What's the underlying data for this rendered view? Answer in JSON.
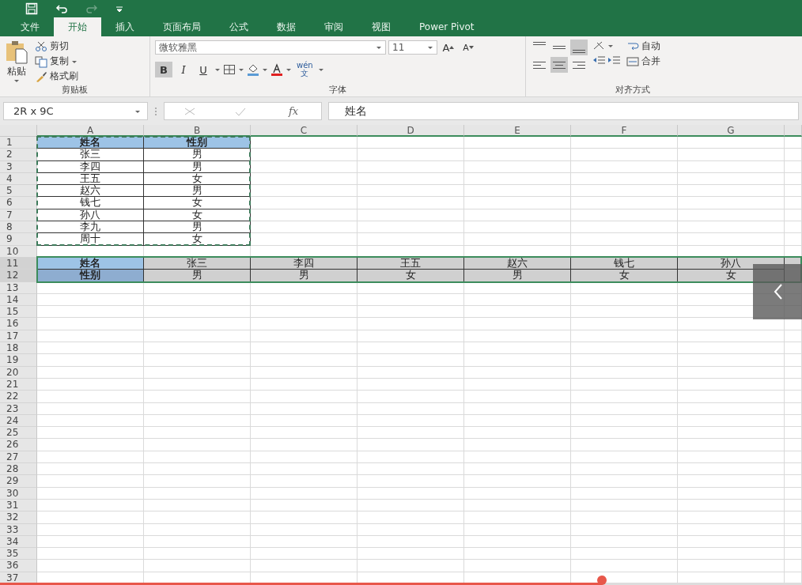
{
  "ribbon_tabs": [
    {
      "label": "文件",
      "selected": false
    },
    {
      "label": "开始",
      "selected": true
    },
    {
      "label": "插入",
      "selected": false
    },
    {
      "label": "页面布局",
      "selected": false
    },
    {
      "label": "公式",
      "selected": false
    },
    {
      "label": "数据",
      "selected": false
    },
    {
      "label": "审阅",
      "selected": false
    },
    {
      "label": "视图",
      "selected": false
    },
    {
      "label": "Power Pivot",
      "selected": false
    }
  ],
  "clipboard": {
    "paste": "粘贴",
    "cut": "剪切",
    "copy": "复制",
    "format_painter": "格式刷",
    "group_label": "剪贴板"
  },
  "font": {
    "name": "微软雅黑",
    "size": "11",
    "grow": "A",
    "shrink": "A",
    "bold": "B",
    "bold_active": true,
    "italic": "I",
    "underline": "U",
    "phonetic_top": "wén",
    "phonetic_bottom": "文",
    "group_label": "字体"
  },
  "alignment": {
    "vertical": [
      {
        "kind": "top",
        "selected": false
      },
      {
        "kind": "middle",
        "selected": false
      },
      {
        "kind": "bottom",
        "selected": true
      }
    ],
    "horizontal": [
      {
        "kind": "left",
        "selected": false
      },
      {
        "kind": "center",
        "selected": true
      },
      {
        "kind": "right",
        "selected": false
      }
    ],
    "wrap": "自动",
    "merge": "合并",
    "group_label": "对齐方式"
  },
  "formula_bar": {
    "name_box": "2R x 9C",
    "fx": "fx",
    "content": "姓名"
  },
  "sheet": {
    "columns": [
      "A",
      "B",
      "C",
      "D",
      "E",
      "F",
      "G"
    ],
    "rows": [
      {
        "header": "1",
        "selected": false,
        "cells": [
          {
            "text": "姓名",
            "kind": "copied_head"
          },
          {
            "text": "性别",
            "kind": "copied_head"
          }
        ]
      },
      {
        "header": "2",
        "selected": false,
        "cells": [
          {
            "text": "张三",
            "kind": "copied"
          },
          {
            "text": "男",
            "kind": "copied"
          }
        ]
      },
      {
        "header": "3",
        "selected": false,
        "cells": [
          {
            "text": "李四",
            "kind": "copied"
          },
          {
            "text": "男",
            "kind": "copied"
          }
        ]
      },
      {
        "header": "4",
        "selected": false,
        "cells": [
          {
            "text": "王五",
            "kind": "copied"
          },
          {
            "text": "女",
            "kind": "copied"
          }
        ]
      },
      {
        "header": "5",
        "selected": false,
        "cells": [
          {
            "text": "赵六",
            "kind": "copied"
          },
          {
            "text": "男",
            "kind": "copied"
          }
        ]
      },
      {
        "header": "6",
        "selected": false,
        "cells": [
          {
            "text": "钱七",
            "kind": "copied"
          },
          {
            "text": "女",
            "kind": "copied"
          }
        ]
      },
      {
        "header": "7",
        "selected": false,
        "cells": [
          {
            "text": "孙八",
            "kind": "copied"
          },
          {
            "text": "女",
            "kind": "copied"
          }
        ]
      },
      {
        "header": "8",
        "selected": false,
        "cells": [
          {
            "text": "李九",
            "kind": "copied"
          },
          {
            "text": "男",
            "kind": "copied"
          }
        ]
      },
      {
        "header": "9",
        "selected": false,
        "cells": [
          {
            "text": "周十",
            "kind": "copied"
          },
          {
            "text": "女",
            "kind": "copied"
          }
        ]
      },
      {
        "header": "10",
        "selected": false
      },
      {
        "header": "11",
        "selected": true,
        "cells": [
          {
            "text": "姓名",
            "kind": "label"
          },
          {
            "text": "张三",
            "kind": "filled"
          },
          {
            "text": "李四",
            "kind": "filled"
          },
          {
            "text": "王五",
            "kind": "filled"
          },
          {
            "text": "赵六",
            "kind": "filled"
          },
          {
            "text": "钱七",
            "kind": "filled"
          },
          {
            "text": "孙八",
            "kind": "filled"
          }
        ]
      },
      {
        "header": "12",
        "selected": true,
        "cells": [
          {
            "text": "性别",
            "kind": "label_dark"
          },
          {
            "text": "男",
            "kind": "filled"
          },
          {
            "text": "男",
            "kind": "filled"
          },
          {
            "text": "女",
            "kind": "filled"
          },
          {
            "text": "男",
            "kind": "filled"
          },
          {
            "text": "女",
            "kind": "filled"
          },
          {
            "text": "女",
            "kind": "filled"
          }
        ]
      },
      {
        "header": "13",
        "selected": false
      },
      {
        "header": "14",
        "selected": false
      },
      {
        "header": "15",
        "selected": false
      },
      {
        "header": "16",
        "selected": false
      },
      {
        "header": "17",
        "selected": false
      },
      {
        "header": "18",
        "selected": false
      },
      {
        "header": "19",
        "selected": false
      },
      {
        "header": "20",
        "selected": false
      },
      {
        "header": "21",
        "selected": false
      },
      {
        "header": "22",
        "selected": false
      },
      {
        "header": "23",
        "selected": false
      },
      {
        "header": "24",
        "selected": false
      },
      {
        "header": "25",
        "selected": false
      },
      {
        "header": "26",
        "selected": false
      },
      {
        "header": "27",
        "selected": false
      },
      {
        "header": "28",
        "selected": false
      },
      {
        "header": "29",
        "selected": false
      },
      {
        "header": "30",
        "selected": false
      },
      {
        "header": "31",
        "selected": false
      },
      {
        "header": "32",
        "selected": false
      },
      {
        "header": "33",
        "selected": false
      },
      {
        "header": "34",
        "selected": false
      },
      {
        "header": "35",
        "selected": false
      },
      {
        "header": "36",
        "selected": false
      },
      {
        "header": "37",
        "selected": false
      }
    ]
  },
  "viewer": {
    "progress": {
      "level": 0.75
    }
  }
}
